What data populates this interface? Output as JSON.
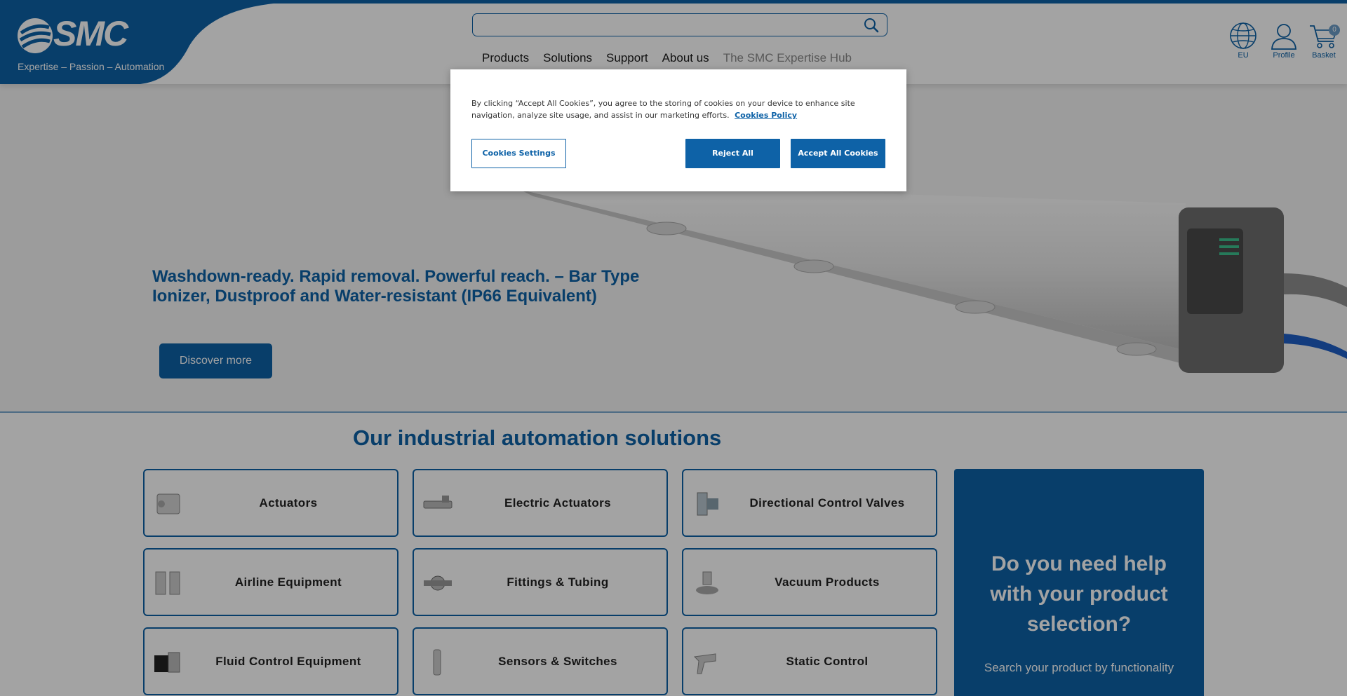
{
  "brand": {
    "logo_text": "SMC",
    "tagline": "Expertise – Passion – Automation",
    "color": "#0e62a7"
  },
  "search": {
    "placeholder": "",
    "icon": "search-icon"
  },
  "nav": {
    "items": [
      "Products",
      "Solutions",
      "Support",
      "About us",
      "The SMC Expertise Hub"
    ]
  },
  "utility": {
    "region_label": "EU",
    "profile_label": "Profile",
    "basket_label": "Basket",
    "basket_count": "0"
  },
  "hero": {
    "title": "Washdown-ready. Rapid removal. Powerful reach. – Bar Type Ionizer, Dustproof and Water-resistant (IP66 Equivalent)",
    "button_label": "Discover more"
  },
  "solutions": {
    "title": "Our industrial automation solutions",
    "categories": [
      "Actuators",
      "Electric Actuators",
      "Directional Control Valves",
      "Airline Equipment",
      "Fittings & Tubing",
      "Vacuum Products",
      "Fluid Control Equipment",
      "Sensors & Switches",
      "Static Control"
    ]
  },
  "help": {
    "title": "Do you need help with your product selection?",
    "subtitle": "Search your product by functionality"
  },
  "cookie": {
    "text": "By clicking “Accept All Cookies”, you agree to the storing of cookies on your device to enhance site navigation, analyze site usage, and assist in our marketing efforts.",
    "policy_link": "Cookies Policy",
    "settings_label": "Cookies Settings",
    "reject_label": "Reject All",
    "accept_label": "Accept All Cookies"
  }
}
